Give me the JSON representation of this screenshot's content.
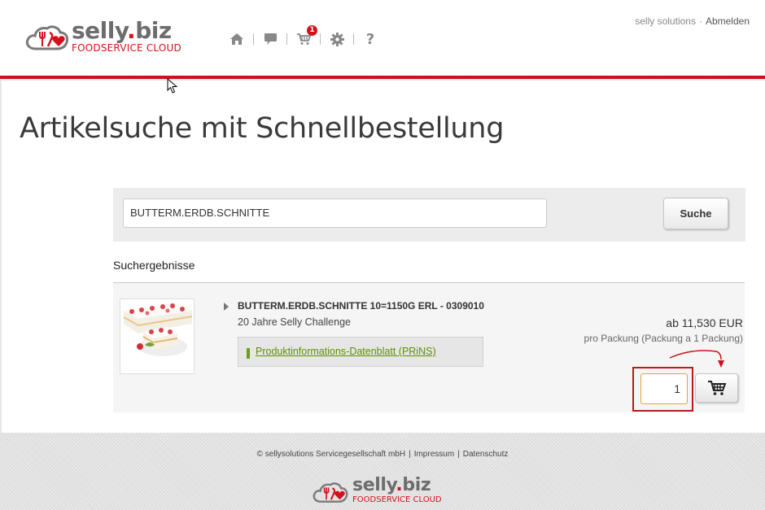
{
  "header": {
    "logo_brand_main": "selly",
    "logo_brand_dot": ".",
    "logo_brand_tld": "biz",
    "logo_tagline": "FOODSERVICE CLOUD",
    "nav": {
      "home_icon": "home-icon",
      "messages_icon": "speech-bubble-icon",
      "cart_icon": "cart-icon",
      "cart_count": "1",
      "settings_icon": "gear-icon",
      "help_label": "?"
    },
    "company": "selly solutions",
    "separator": "·",
    "logout_label": "Abmelden"
  },
  "page": {
    "title": "Artikelsuche mit Schnellbestellung"
  },
  "search": {
    "value": "BUTTERM.ERDB.SCHNITTE",
    "button_label": "Suche"
  },
  "results": {
    "heading": "Suchergebnisse",
    "items": [
      {
        "name": "BUTTERM.ERDB.SCHNITTE 10=1150G ERL - 0309010",
        "subtitle": "20 Jahre Selly Challenge",
        "info_link": "Produktinformations-Datenblatt (PRiNS)",
        "price": "ab 11,530 EUR",
        "packaging": "pro Packung (Packung a 1 Packung)",
        "quantity": "1",
        "add_to_cart_icon": "cart-add-icon"
      }
    ]
  },
  "footer": {
    "copyright": "© sellysolutions Servicegesellschaft mbH",
    "separator": "|",
    "impressum": "Impressum",
    "datenschutz": "Datenschutz"
  },
  "colors": {
    "brand_red": "#c8131b",
    "brand_gray": "#6d6d6d",
    "link_green": "#5e8f00",
    "qty_border": "#e0a340"
  }
}
